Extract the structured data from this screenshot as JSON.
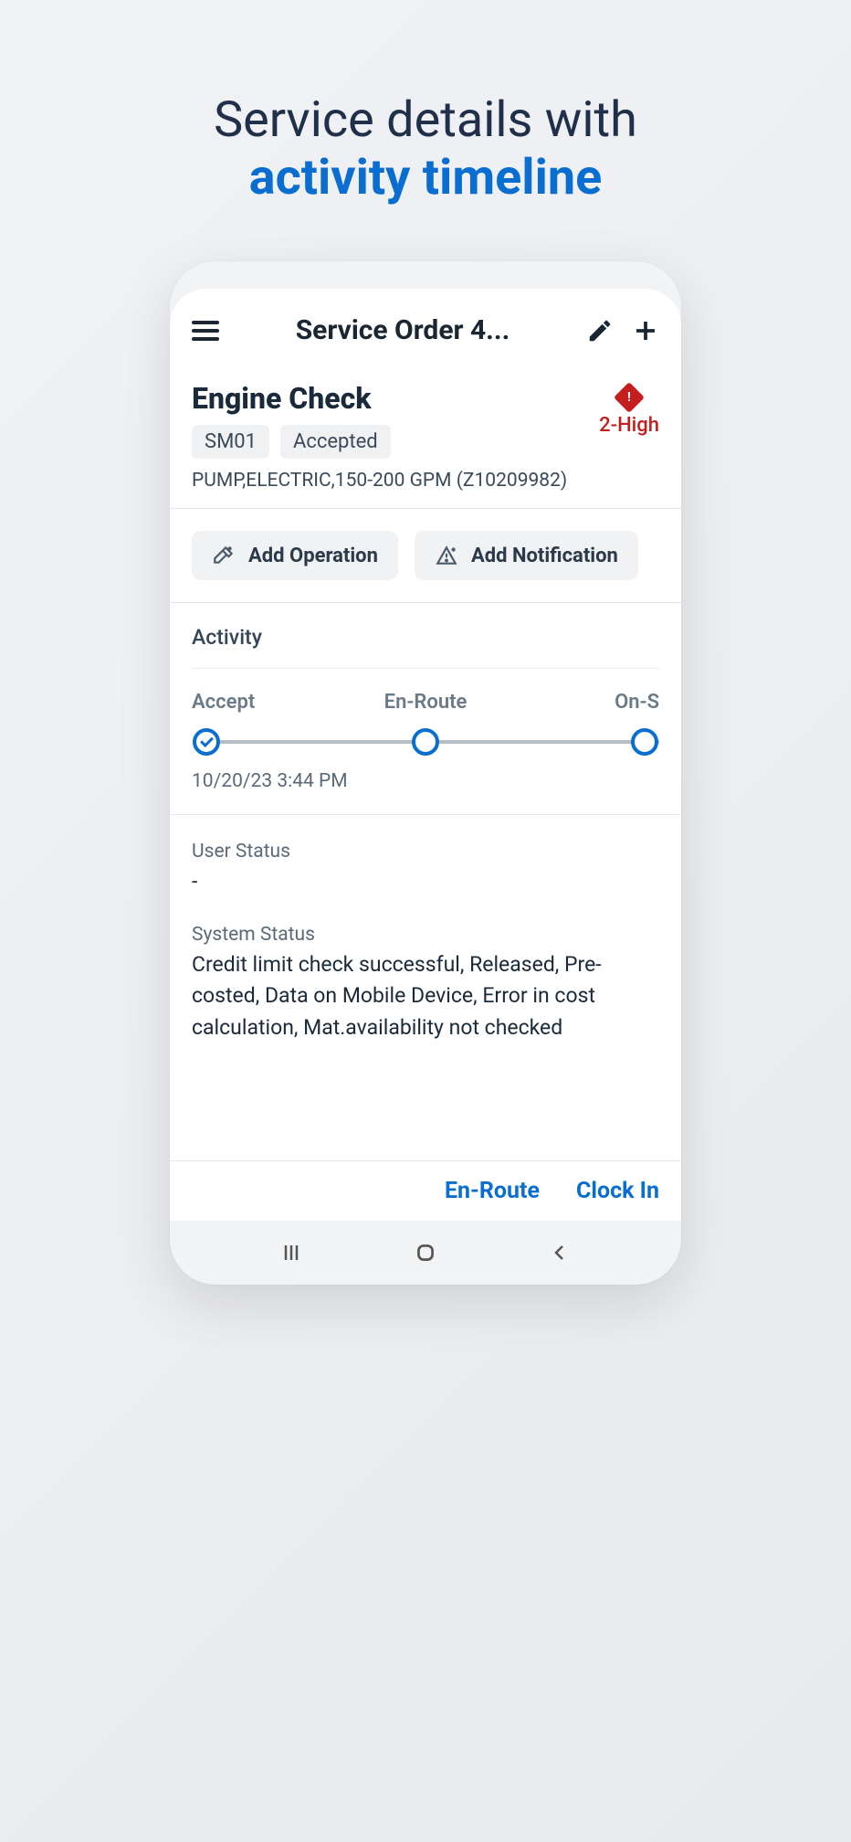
{
  "promo": {
    "line1": "Service details with",
    "line2": "activity timeline"
  },
  "header": {
    "title": "Service Order 4..."
  },
  "order": {
    "title": "Engine Check",
    "tags": [
      "SM01",
      "Accepted"
    ],
    "priority_label": "2-High",
    "equipment": "PUMP,ELECTRIC,150-200 GPM (Z10209982)"
  },
  "actions": {
    "add_operation": "Add Operation",
    "add_notification": "Add Notification"
  },
  "activity": {
    "section_label": "Activity",
    "steps": [
      "Accept",
      "En-Route",
      "On-S"
    ],
    "timestamp": "10/20/23 3:44 PM"
  },
  "status": {
    "user_label": "User Status",
    "user_value": "-",
    "system_label": "System Status",
    "system_value": "Credit limit check successful, Released, Pre-costed, Data on Mobile Device, Error in cost calculation, Mat.availability not checked"
  },
  "footer": {
    "en_route": "En-Route",
    "clock_in": "Clock In"
  }
}
